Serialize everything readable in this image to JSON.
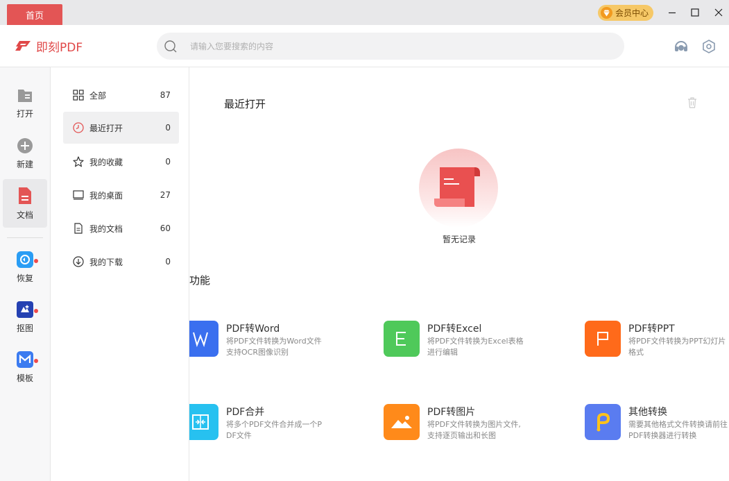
{
  "titlebar": {
    "home_tab": "首页",
    "vip_label": "会员中心"
  },
  "header": {
    "app_name": "即刻PDF",
    "search_placeholder": "请输入您要搜索的内容"
  },
  "rail": {
    "items": [
      {
        "label": "打开",
        "icon": "folder-open-icon"
      },
      {
        "label": "新建",
        "icon": "plus-circle-icon"
      },
      {
        "label": "文档",
        "icon": "document-icon"
      },
      {
        "label": "恢复",
        "icon": "recover-icon"
      },
      {
        "label": "抠图",
        "icon": "cutout-icon"
      },
      {
        "label": "模板",
        "icon": "template-icon"
      }
    ]
  },
  "categories": [
    {
      "label": "全部",
      "count": "87",
      "icon": "grid-icon"
    },
    {
      "label": "最近打开",
      "count": "0",
      "icon": "clock-icon"
    },
    {
      "label": "我的收藏",
      "count": "0",
      "icon": "star-icon"
    },
    {
      "label": "我的桌面",
      "count": "27",
      "icon": "monitor-icon"
    },
    {
      "label": "我的文档",
      "count": "60",
      "icon": "file-icon"
    },
    {
      "label": "我的下载",
      "count": "0",
      "icon": "download-icon"
    }
  ],
  "main": {
    "recent_title": "最近打开",
    "empty_text": "暂无记录",
    "features_title": "功能",
    "features": [
      {
        "title": "PDF转Word",
        "desc": "将PDF文件转换为Word文件支持OCR图像识别",
        "color": "#3a6fef"
      },
      {
        "title": "PDF转Excel",
        "desc": "将PDF文件转换为Excel表格进行编辑",
        "color": "#4fc95a"
      },
      {
        "title": "PDF转PPT",
        "desc": "将PDF文件转换为PPT幻灯片格式",
        "color": "#ff6a1a"
      },
      {
        "title": "PDF合并",
        "desc": "将多个PDF文件合并成一个PDF文件",
        "color": "#27c1f0"
      },
      {
        "title": "PDF转图片",
        "desc": "将PDF文件转换为图片文件,支持逐页输出和长图",
        "color": "#ff8a1a"
      },
      {
        "title": "其他转换",
        "desc": "需要其他格式文件转换请前往PDF转换器进行转换",
        "color": "#5a7cf0"
      }
    ]
  },
  "colors": {
    "accent": "#e35555",
    "vip": "#f6c867"
  }
}
